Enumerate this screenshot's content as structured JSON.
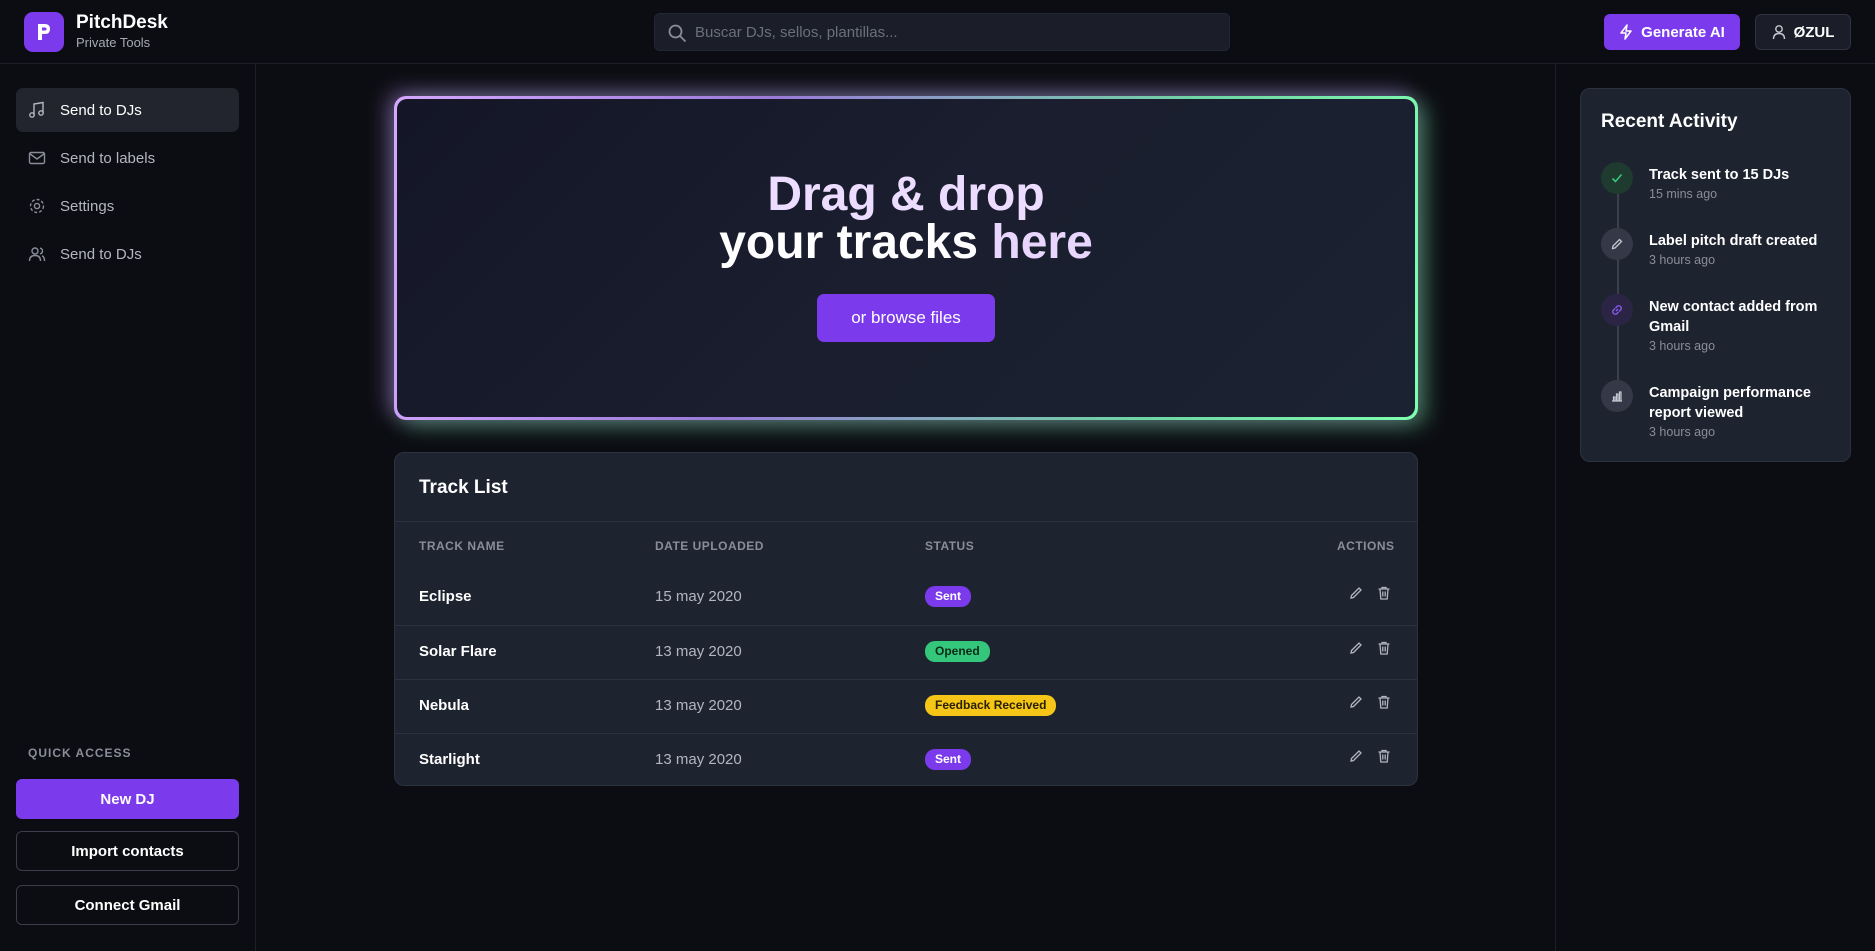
{
  "header": {
    "brand_name": "PitchDesk",
    "brand_sub": "Private Tools",
    "search_placeholder": "Buscar DJs, sellos, plantillas...",
    "generate_label": "Generate AI",
    "user_label": "ØZUL"
  },
  "sidebar": {
    "items": [
      {
        "label": "Send to DJs",
        "icon": "music-note-icon",
        "active": true
      },
      {
        "label": "Send to labels",
        "icon": "mail-icon",
        "active": false
      },
      {
        "label": "Settings",
        "icon": "gear-icon",
        "active": false
      },
      {
        "label": "Send to DJs",
        "icon": "users-icon",
        "active": false
      }
    ],
    "quick_access_label": "QUICK ACCESS",
    "buttons": {
      "new_dj": "New DJ",
      "import_contacts": "Import contacts",
      "connect_gmail": "Connect Gmail"
    }
  },
  "dropzone": {
    "title_line1": "Drag & drop",
    "title_line2_a": "your tracks ",
    "title_line2_b": "here",
    "browse_label": "or browse files"
  },
  "tracklist": {
    "title": "Track List",
    "columns": [
      "TRACK NAME",
      "DATE UPLOADED",
      "STATUS",
      "ACTIONS"
    ],
    "rows": [
      {
        "name": "Eclipse",
        "date": "15 may 2020",
        "status": "Sent"
      },
      {
        "name": "Solar Flare",
        "date": "13 may 2020",
        "status": "Opened"
      },
      {
        "name": "Nebula",
        "date": "13 may 2020",
        "status": "Feedback Received"
      },
      {
        "name": "Starlight",
        "date": "13 may 2020",
        "status": "Sent"
      }
    ]
  },
  "activity": {
    "title": "Recent Activity",
    "items": [
      {
        "text": "Track sent to 15 DJs",
        "time": "15 mins ago",
        "icon": "check-icon"
      },
      {
        "text": "Label pitch draft created",
        "time": "3 hours ago",
        "icon": "pencil-icon"
      },
      {
        "text": "New contact added from Gmail",
        "time": "3 hours ago",
        "icon": "link-icon"
      },
      {
        "text": "Campaign performance report viewed",
        "time": "3 hours ago",
        "icon": "bar-chart-icon"
      }
    ]
  },
  "colors": {
    "accent": "#7c3aed",
    "sent": "#7c3aed",
    "opened": "#34c77b",
    "feedback": "#f5c518"
  }
}
